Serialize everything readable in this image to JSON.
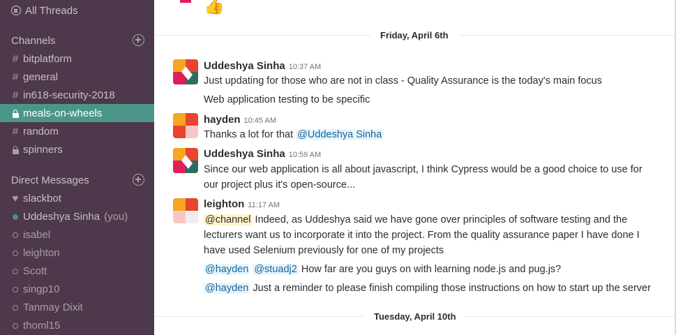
{
  "sidebar": {
    "all_threads": "All Threads",
    "channels_header": "Channels",
    "channels": [
      {
        "name": "bitplatform",
        "prefix": "#"
      },
      {
        "name": "general",
        "prefix": "#"
      },
      {
        "name": "in618-security-2018",
        "prefix": "#"
      },
      {
        "name": "meals-on-wheels",
        "prefix": "lock",
        "active": true
      },
      {
        "name": "random",
        "prefix": "#"
      },
      {
        "name": "spinners",
        "prefix": "lock"
      }
    ],
    "dm_header": "Direct Messages",
    "dms": [
      {
        "name": "slackbot",
        "status": "heart"
      },
      {
        "name": "Uddeshya Sinha",
        "suffix": "(you)",
        "status": "online"
      },
      {
        "name": "isabel",
        "status": "away"
      },
      {
        "name": "leighton",
        "status": "away"
      },
      {
        "name": "Scott",
        "status": "away"
      },
      {
        "name": "singp10",
        "status": "away"
      },
      {
        "name": "Tanmay Dixit",
        "status": "away"
      },
      {
        "name": "thoml15",
        "status": "away"
      }
    ]
  },
  "main": {
    "top_emoji": "👍",
    "day1": "Friday, April 6th",
    "day2": "Tuesday, April 10th",
    "messages": [
      {
        "author": "Uddeshya Sinha",
        "time": "10:37 AM",
        "line1": "Just updating for those who are not in class - Quality Assurance is the today's main focus",
        "line2": "Web application testing to be specific"
      },
      {
        "author": "hayden",
        "time": "10:45 AM",
        "text": "Thanks a lot for that",
        "mention": "@Uddeshya Sinha"
      },
      {
        "author": "Uddeshya Sinha",
        "time": "10:59 AM",
        "line1": "Since our web application is all about javascript, I think Cypress would be a good choice to use for",
        "line2": "our project plus it's open-source..."
      },
      {
        "author": "leighton",
        "time": "11:17 AM",
        "channel_mention": "@channel",
        "line1": "Indeed, as Uddeshya said we have gone over principles of software testing and the",
        "line2": "lecturers want us to incorporate it into the project. From the quality assurance paper I have done I",
        "line3": "have used Selenium previously for one of my projects",
        "m1": "@hayden",
        "m2": "@stuadj2",
        "line4": "How far are you guys on with learning node.js and pug.js?",
        "m3": "@hayden",
        "line5": "Just a reminder to please finish compiling those instructions on how to start up the server"
      }
    ]
  }
}
